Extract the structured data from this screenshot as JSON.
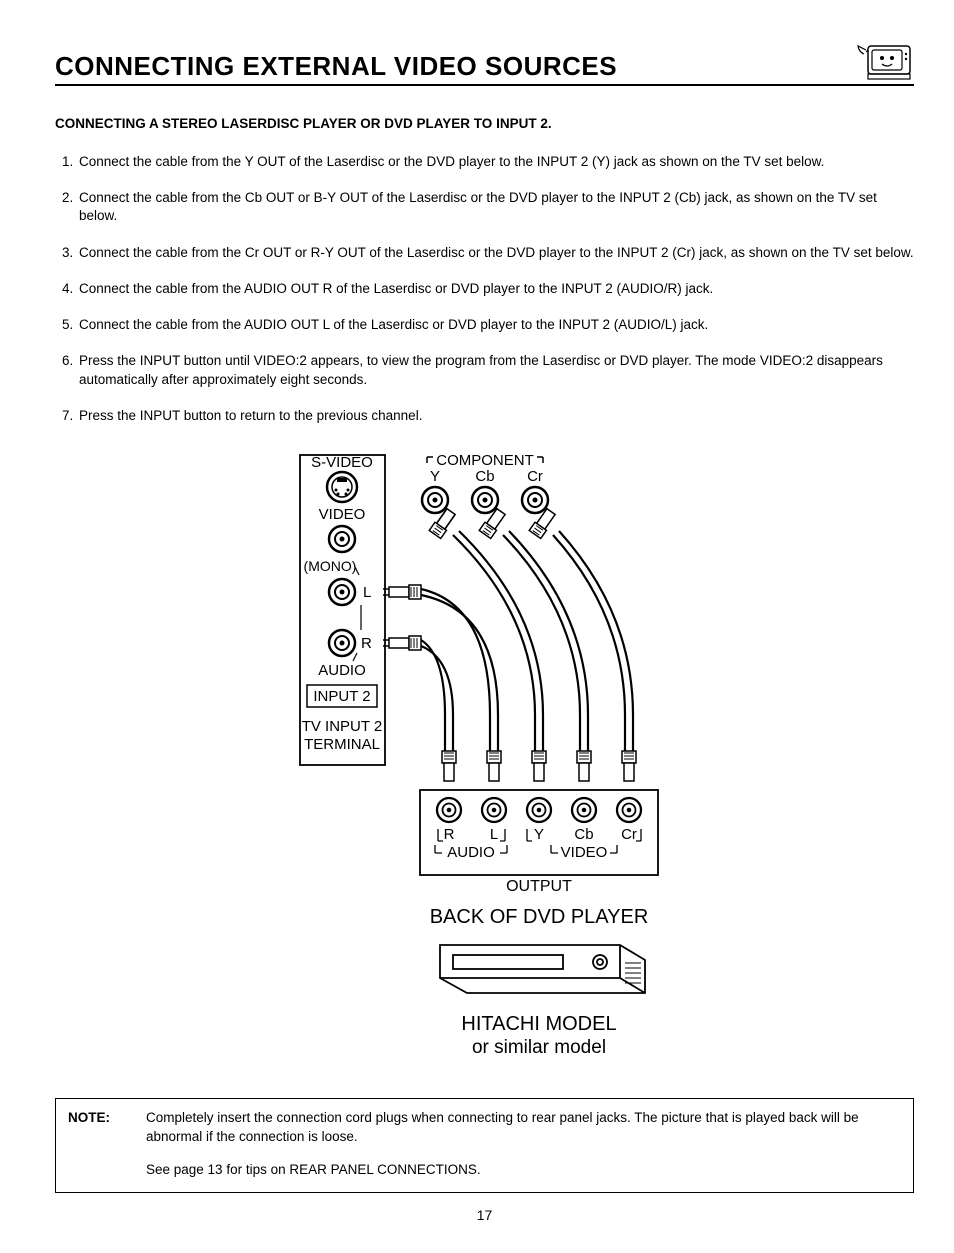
{
  "header": {
    "title": "CONNECTING EXTERNAL VIDEO SOURCES"
  },
  "subheading": "CONNECTING A STEREO LASERDISC PLAYER OR DVD PLAYER TO INPUT 2.",
  "steps": [
    "Connect  the cable from the Y OUT of the Laserdisc or the DVD player to the INPUT 2 (Y) jack as shown on the TV set below.",
    "Connect the cable from the Cb OUT or B-Y OUT of the Laserdisc or the DVD player to the INPUT 2 (Cb) jack, as shown on the TV set below.",
    "Connect the cable from the Cr OUT or R-Y OUT of the Laserdisc or the DVD player to the INPUT 2 (Cr) jack, as shown on the TV set below.",
    "Connect the cable from the AUDIO OUT R of the Laserdisc or DVD player to the INPUT 2 (AUDIO/R) jack.",
    "Connect the cable from the AUDIO OUT L of the Laserdisc or DVD player to the INPUT 2 (AUDIO/L) jack.",
    "Press the INPUT button until VIDEO:2 appears, to view the program from the Laserdisc or DVD player.  The mode VIDEO:2 disappears automatically after approximately eight seconds.",
    "Press the INPUT button to return to the previous channel."
  ],
  "diagram": {
    "tv_panel": {
      "svideo": "S-VIDEO",
      "component": "COMPONENT",
      "y": "Y",
      "cb": "Cb",
      "cr": "Cr",
      "video": "VIDEO",
      "mono": "(MONO)",
      "l": "L",
      "r": "R",
      "audio": "AUDIO",
      "input2": "INPUT 2",
      "terminal1": "TV INPUT 2",
      "terminal2": "TERMINAL"
    },
    "dvd_panel": {
      "r": "R",
      "l": "L",
      "y": "Y",
      "cb": "Cb",
      "cr": "Cr",
      "audio": "AUDIO",
      "video": "VIDEO",
      "output": "OUTPUT",
      "back": "BACK OF DVD PLAYER",
      "brand": "HITACHI MODEL",
      "similar": "or similar model"
    }
  },
  "note": {
    "label": "NOTE:",
    "text": "Completely insert the connection cord plugs when connecting to rear panel jacks.  The picture that is played back will be abnormal if the connection is loose.",
    "extra": "See page 13 for tips on REAR PANEL CONNECTIONS."
  },
  "page_number": "17"
}
